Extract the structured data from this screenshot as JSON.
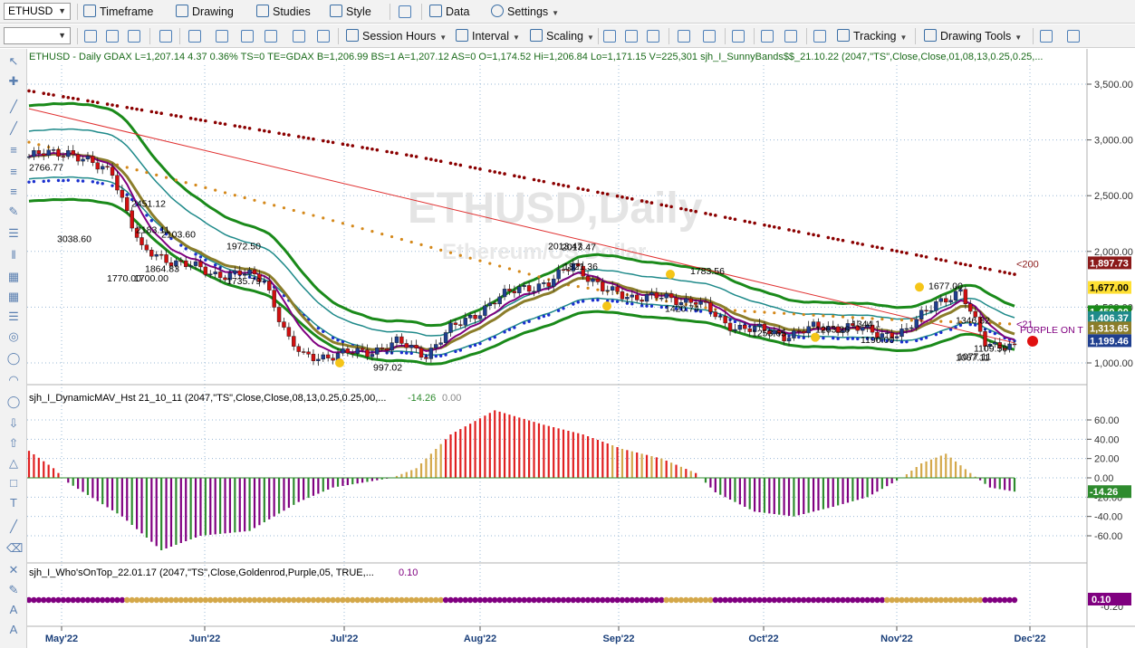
{
  "toolbar1": {
    "symbol": "ETHUSD",
    "timeframe": "Timeframe",
    "drawing": "Drawing",
    "studies": "Studies",
    "style": "Style",
    "data": "Data",
    "settings": "Settings"
  },
  "toolbar2": {
    "session_hours": "Session Hours",
    "interval": "Interval",
    "scaling": "Scaling",
    "tracking": "Tracking",
    "drawing_tools": "Drawing Tools"
  },
  "colors": {
    "up_candle": "#1f3f8f",
    "down_candle": "#d01010",
    "band_outer": "#1a8a1a",
    "band_inner": "#1f8a8a",
    "ma_purple": "#800080",
    "ma_olive": "#8b7d2a",
    "dots_blue": "#1a2fcf",
    "dots_orange": "#d4881a",
    "dots_maroon": "#8b0000",
    "hist_gold": "#d4a84a",
    "hist_red": "#e02020",
    "hist_purple": "#800080",
    "hist_green": "#2e8b2e"
  },
  "main_panel": {
    "header": "ETHUSD - Daily  GDAX  L=1,207.14  4.37  0.36%  TS=0  TE=GDAX  B=1,206.99  BS=1  A=1,207.12  AS=0  O=1,174.52  Hi=1,206.84  Lo=1,171.15  V=225,301  sjh_I_SunnyBands$$_21.10.22 (2047,\"TS\",Close,Close,01,08,13,0.25,0.25,...",
    "watermark_title": "ETHUSD,Daily",
    "watermark_sub": "Ethereum/US Dollar",
    "label_200": "<200",
    "label_21": "<21",
    "label_purple_on": "PURPLE ON T",
    "price_labels": [
      "3038.60",
      "2766.77",
      "2451.12",
      "2183.11",
      "2103.60",
      "1864.83",
      "1770.00",
      "1700.00",
      "1972.50",
      "1735.79",
      "997.02",
      "2013.47",
      "2013.47",
      "1821.36",
      "1783.56",
      "1420.74",
      "1253.65",
      "1344.1",
      "1263.26",
      "1190.00",
      "1677.00",
      "1346.82",
      "1077.11",
      "1067.11",
      "1109.50"
    ],
    "axis_ticks": [
      "3,500.00",
      "3,000.00",
      "2,500.00",
      "2,000.00",
      "1,500.00",
      "1,000.00"
    ],
    "badges": [
      {
        "text": "1,897.73",
        "color": "#8b1a1a",
        "fg": "#fff"
      },
      {
        "text": "1,677.00",
        "color": "#ffe033",
        "fg": "#000"
      },
      {
        "text": "1,459.00",
        "color": "#1a8a1a",
        "fg": "#fff"
      },
      {
        "text": "1,406.37",
        "color": "#1f8a8a",
        "fg": "#fff"
      },
      {
        "text": "1,313.65",
        "color": "#8b7d2a",
        "fg": "#fff"
      },
      {
        "text": "1,199.46",
        "color": "#1f3f8f",
        "fg": "#fff"
      }
    ]
  },
  "hist_panel": {
    "header": "sjh_I_DynamicMAV_Hst 21_10_11 (2047,\"TS\",Close,Close,08,13,0.25,0.25,00,...",
    "value": "-14.26",
    "value2": "0.00",
    "axis_ticks": [
      "60.00",
      "40.00",
      "20.00",
      "0.00",
      "-20.00",
      "-40.00",
      "-60.00"
    ],
    "badge": "-14.26"
  },
  "dots_panel": {
    "header": "sjh_I_Who'sOnTop_22.01.17 (2047,\"TS\",Close,Goldenrod,Purple,05, TRUE,...",
    "value": "0.10",
    "axis_ticks": [
      "-0.20"
    ],
    "badge": "0.10"
  },
  "x_axis": [
    "May'22",
    "Jun'22",
    "Jul'22",
    "Aug'22",
    "Sep'22",
    "Oct'22",
    "Nov'22",
    "Dec'22"
  ],
  "chart_data": {
    "type": "line",
    "title": "ETHUSD,Daily",
    "subtitle": "Ethereum/US Dollar",
    "xlabel": "",
    "ylabel": "",
    "ylim": [
      800,
      3700
    ],
    "x": [
      "May'22",
      "Jun'22",
      "Jul'22",
      "Aug'22",
      "Sep'22",
      "Oct'22",
      "Nov'22",
      "Dec'22"
    ],
    "series": [
      {
        "name": "Close",
        "values": [
          2900,
          1800,
          1100,
          1650,
          1500,
          1330,
          1230,
          1207
        ]
      },
      {
        "name": "200",
        "values": [
          3400,
          3250,
          3000,
          2650,
          2300,
          2050,
          1950,
          1898
        ]
      },
      {
        "name": "21",
        "values": [
          2800,
          1900,
          1300,
          1550,
          1560,
          1350,
          1250,
          1210
        ]
      }
    ],
    "histogram": {
      "name": "sjh_I_DynamicMAV_Hst",
      "x": [
        "May'22",
        "Jun'22",
        "Jul'22",
        "Aug'22",
        "Sep'22",
        "Oct'22",
        "Nov'22",
        "Dec'22"
      ],
      "values": [
        30,
        -70,
        -50,
        60,
        20,
        -35,
        25,
        -14.26
      ],
      "ylim": [
        -70,
        70
      ]
    },
    "dots": {
      "name": "sjh_I_Who'sOnTop",
      "value": 0.1
    }
  }
}
